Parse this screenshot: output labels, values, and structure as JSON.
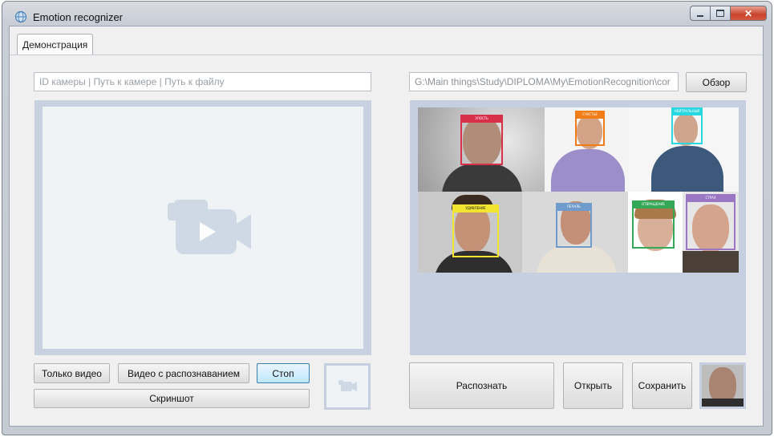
{
  "window": {
    "title": "Emotion recognizer"
  },
  "tabs": [
    {
      "label": "Демонстрация"
    }
  ],
  "camera": {
    "input_placeholder": "ID камеры | Путь к камере | Путь к файлу",
    "buttons": {
      "video_only": "Только видео",
      "video_recognition": "Видео с распознаванием",
      "stop": "Стоп",
      "screenshot": "Скриншот"
    }
  },
  "image": {
    "path_value": "G:\\Main things\\Study\\DIPLOMA\\My\\EmotionRecognition\\cor",
    "browse": "Обзор",
    "buttons": {
      "recognize": "Распознать",
      "open": "Открыть",
      "save": "Сохранить"
    },
    "detections": [
      {
        "label": "ЗЛОСТЬ",
        "color": "#d9304a"
      },
      {
        "label": "СЧАСТЬЕ",
        "color": "#f07d18"
      },
      {
        "label": "НЕЙТРАЛЬНЫЙ",
        "color": "#28d8e0"
      },
      {
        "label": "УДИВЛЕНИЕ",
        "color": "#f2e530"
      },
      {
        "label": "ПЕЧАЛЬ",
        "color": "#6f9ccc"
      },
      {
        "label": "ОТВРАЩЕНИЕ",
        "color": "#34a857"
      },
      {
        "label": "СТРАХ",
        "color": "#9a76c4"
      }
    ]
  },
  "colors": {
    "frame": "#c8d1e0",
    "focus_border": "#3c7fb1"
  }
}
